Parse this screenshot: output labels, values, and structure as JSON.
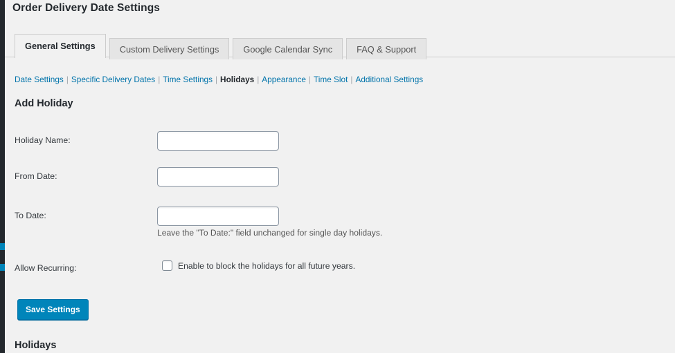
{
  "page": {
    "title": "Order Delivery Date Settings"
  },
  "tabs": [
    {
      "label": "General Settings",
      "active": true
    },
    {
      "label": "Custom Delivery Settings",
      "active": false
    },
    {
      "label": "Google Calendar Sync",
      "active": false
    },
    {
      "label": "FAQ & Support",
      "active": false
    }
  ],
  "subnav": {
    "items": [
      {
        "label": "Date Settings",
        "active": false
      },
      {
        "label": "Specific Delivery Dates",
        "active": false
      },
      {
        "label": "Time Settings",
        "active": false
      },
      {
        "label": "Holidays",
        "active": true
      },
      {
        "label": "Appearance",
        "active": false
      },
      {
        "label": "Time Slot",
        "active": false
      },
      {
        "label": "Additional Settings",
        "active": false
      }
    ],
    "separator": "|"
  },
  "add_holiday": {
    "heading": "Add Holiday",
    "fields": {
      "holiday_name": {
        "label": "Holiday Name:",
        "value": "",
        "placeholder": ""
      },
      "from_date": {
        "label": "From Date:",
        "value": "",
        "placeholder": ""
      },
      "to_date": {
        "label": "To Date:",
        "value": "",
        "placeholder": "",
        "help": "Leave the \"To Date:\" field unchanged for single day holidays."
      },
      "allow_recurring": {
        "label": "Allow Recurring:",
        "checkbox_label": "Enable to block the holidays for all future years.",
        "checked": false
      }
    },
    "save_label": "Save Settings"
  },
  "holidays_section": {
    "heading": "Holidays"
  },
  "colors": {
    "admin_rail": "#23282d",
    "accent_blue": "#0085ba",
    "link_blue": "#0073aa",
    "page_background": "#f1f1f1",
    "tab_inactive": "#e5e5e5",
    "border": "#cccccc"
  }
}
